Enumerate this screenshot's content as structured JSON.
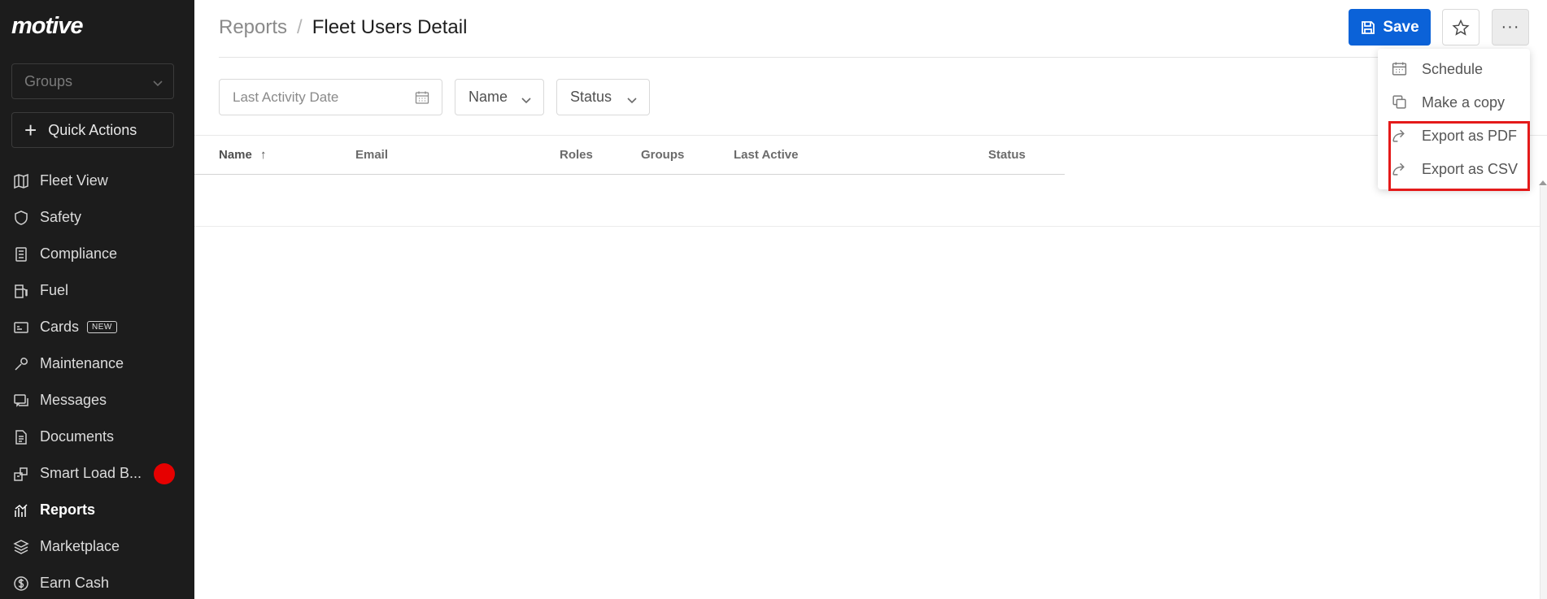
{
  "brand": {
    "logo_text": "motive"
  },
  "sidebar": {
    "groups_placeholder": "Groups",
    "quick_actions_label": "Quick Actions",
    "items": [
      {
        "label": "Fleet View",
        "icon": "map-icon"
      },
      {
        "label": "Safety",
        "icon": "shield-icon"
      },
      {
        "label": "Compliance",
        "icon": "checklist-icon"
      },
      {
        "label": "Fuel",
        "icon": "fuel-pump-icon"
      },
      {
        "label": "Cards",
        "icon": "card-icon",
        "badge": "NEW"
      },
      {
        "label": "Maintenance",
        "icon": "wrench-icon"
      },
      {
        "label": "Messages",
        "icon": "chat-icon"
      },
      {
        "label": "Documents",
        "icon": "document-icon"
      },
      {
        "label": "Smart Load B...",
        "icon": "smart-load-icon",
        "notification_dot": true
      },
      {
        "label": "Reports",
        "icon": "reports-chart-icon",
        "active": true
      },
      {
        "label": "Marketplace",
        "icon": "layers-icon"
      },
      {
        "label": "Earn Cash",
        "icon": "dollar-circle-icon"
      }
    ]
  },
  "header": {
    "breadcrumb_root": "Reports",
    "breadcrumb_separator": "/",
    "title": "Fleet Users Detail",
    "save_label": "Save",
    "more_label": "···"
  },
  "filters": {
    "date_placeholder": "Last Activity Date",
    "name_label": "Name",
    "status_label": "Status"
  },
  "table": {
    "columns": [
      "Name",
      "Email",
      "Roles",
      "Groups",
      "Last Active",
      "Status"
    ],
    "sort_column": "Name",
    "sort_direction_glyph": "↑",
    "rows": []
  },
  "more_menu": {
    "items": [
      {
        "label": "Schedule",
        "icon": "calendar-icon"
      },
      {
        "label": "Make a copy",
        "icon": "copy-icon"
      },
      {
        "label": "Export as PDF",
        "icon": "export-icon",
        "highlighted": true
      },
      {
        "label": "Export as CSV",
        "icon": "export-icon",
        "highlighted": true
      }
    ]
  },
  "colors": {
    "sidebar_bg": "#1c1c1c",
    "primary": "#0b62d8",
    "notification": "#e60000",
    "highlight": "#e41a1a"
  }
}
